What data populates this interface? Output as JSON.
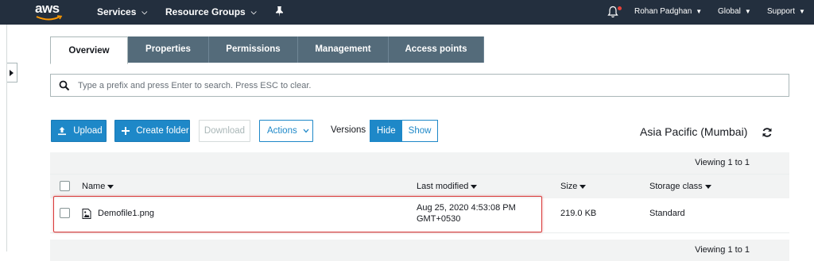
{
  "topnav": {
    "logo": "aws",
    "services": "Services",
    "resource_groups": "Resource Groups",
    "user": "Rohan Padghan",
    "region_menu": "Global",
    "support": "Support"
  },
  "tabs": [
    {
      "label": "Overview",
      "active": true
    },
    {
      "label": "Properties",
      "active": false
    },
    {
      "label": "Permissions",
      "active": false
    },
    {
      "label": "Management",
      "active": false
    },
    {
      "label": "Access points",
      "active": false
    }
  ],
  "search": {
    "placeholder": "Type a prefix and press Enter to search. Press ESC to clear."
  },
  "toolbar": {
    "upload": "Upload",
    "create_folder": "Create folder",
    "download": "Download",
    "actions": "Actions",
    "versions_label": "Versions",
    "hide": "Hide",
    "show": "Show",
    "region": "Asia Pacific (Mumbai)"
  },
  "table": {
    "viewing": "Viewing 1 to 1",
    "columns": {
      "name": "Name",
      "last_modified": "Last modified",
      "size": "Size",
      "storage_class": "Storage class"
    },
    "rows": [
      {
        "name": "Demofile1.png",
        "last_modified_line1": "Aug 25, 2020 4:53:08 PM",
        "last_modified_line2": "GMT+0530",
        "size": "219.0 KB",
        "storage_class": "Standard"
      }
    ]
  },
  "colors": {
    "nav_bg": "#232f3e",
    "tab_bg": "#546b7a",
    "primary": "#1e88c8",
    "highlight": "#d93a3a"
  }
}
